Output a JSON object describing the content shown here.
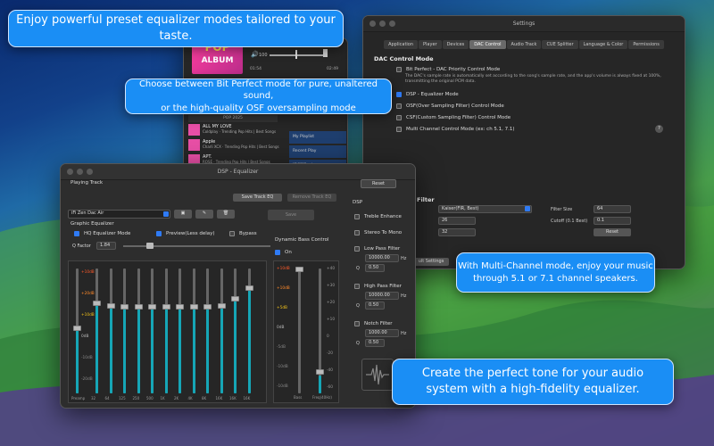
{
  "callouts": {
    "presets": "Enjoy powerful preset equalizer modes tailored to your taste.",
    "bitperfect_line1": "Choose between Bit Perfect mode for pure, unaltered sound,",
    "bitperfect_line2": "or the high-quality OSF oversampling mode",
    "multichannel_line1": "With Multi-Channel mode, enjoy your music",
    "multichannel_line2": "through 5.1 or 7.1 channel speakers.",
    "tone_line1": "Create the perfect tone for your audio",
    "tone_line2": "system with a high-fidelity equalizer."
  },
  "player": {
    "album_art_text": "POP",
    "album_art_sub": "ALBUM",
    "volume": "100",
    "time_elapsed": "01:54",
    "time_total": "02:49",
    "playlist_header": "POP 2025",
    "tracks": [
      {
        "title": "ALL MY LOVE",
        "artist": "Coldplay · Trending Pop Hits | Best Songs"
      },
      {
        "title": "Apple",
        "artist": "Charli XCX · Trending Pop Hits | Best Songs"
      },
      {
        "title": "APT.",
        "artist": "ROSÉ · Trending Pop Hits | Best Songs"
      }
    ],
    "side_items": [
      "My Playlist",
      "Recent Play",
      "[DSF]Eagles"
    ]
  },
  "settings": {
    "title": "Settings",
    "tabs": [
      "Application",
      "Player",
      "Devices",
      "DAC Control",
      "Audio Track",
      "CUE Splitter",
      "Language & Color",
      "Permissions"
    ],
    "active_tab": "DAC Control",
    "section": "DAC Control Mode",
    "options": [
      {
        "label": "Bit Perfect - DAC Priority Control Mode",
        "checked": false
      },
      {
        "label": "DSP - Equalizer Mode",
        "checked": true
      },
      {
        "label": "OSF(Over Sampling Filter) Control Mode",
        "checked": false
      },
      {
        "label": "CSF(Custom Sampling Filter) Control Mode",
        "checked": false
      },
      {
        "label": "Multi Channel Control Mode (ex: ch 5.1, 7.1)",
        "checked": false
      }
    ],
    "bitperfect_desc": "The DAC's sample rate is automatically set according to the song's sample rate, and the app's volume is always fixed at 100%, transmitting the original PCM data.",
    "filter_heading": "Filter",
    "filter_type": "Kaiser(FIR, Best)",
    "filter_size_label": "Filter Size",
    "filter_size": "64",
    "cutoff_label": "Cutoff (0.1 Best)",
    "cutoff": "0.1",
    "param1": "26",
    "param2": "32",
    "reset": "Reset",
    "default_btn": "ult Settings"
  },
  "eq": {
    "title": "DSP - Equalizer",
    "playing_track": "Playing Track",
    "reset": "Reset",
    "save_track_eq": "Save Track EQ",
    "remove_track_eq": "Remove Track EQ",
    "preset": "iFi Zen Dac Air",
    "save": "Save",
    "graphic_eq": "Graphic Equalizer",
    "hq_mode": "HQ Equalizer Mode",
    "preview": "Preview(Less delay)",
    "bypass": "Bypass",
    "q_factor_label": "Q Factor",
    "q_factor": "1.84",
    "db_labels": [
      "+10dB",
      "+20dB",
      "+10dB",
      "0dB",
      "-10dB",
      "-20dB"
    ],
    "bands": [
      {
        "freq": "Preamp",
        "level": 0.52
      },
      {
        "freq": "32",
        "level": 0.72
      },
      {
        "freq": "64",
        "level": 0.7
      },
      {
        "freq": "125",
        "level": 0.69
      },
      {
        "freq": "250",
        "level": 0.69
      },
      {
        "freq": "500",
        "level": 0.69
      },
      {
        "freq": "1K",
        "level": 0.69
      },
      {
        "freq": "2K",
        "level": 0.69
      },
      {
        "freq": "4K",
        "level": 0.69
      },
      {
        "freq": "8K",
        "level": 0.69
      },
      {
        "freq": "16K",
        "level": 0.7
      },
      {
        "freq": "16K",
        "level": 0.76
      },
      {
        "freq": "16K",
        "level": 0.84
      }
    ],
    "dynamic_bass": "Dynamic Bass Control",
    "on": "On",
    "bass_db_left": [
      "+10dB",
      "+10dB",
      "+5dB",
      "0dB",
      "-5dB",
      "-10dB",
      "-10dB"
    ],
    "bass_db_right": [
      "+40",
      "+30",
      "+20",
      "+10",
      "0",
      "-20",
      "-40",
      "-60"
    ],
    "bass_bottom": [
      "Bass",
      "Freq(40Hz)"
    ],
    "dsp": "DSP",
    "treble": "Treble Enhance",
    "stereo_mono": "Stereo To Mono",
    "low_pass": "Low Pass Filter",
    "low_pass_hz": "10000.00",
    "low_pass_q": "0.50",
    "high_pass": "High Pass Filter",
    "high_pass_hz": "10000.00",
    "high_pass_q": "0.50",
    "notch": "Notch Filter",
    "notch_hz": "1000.00",
    "notch_q": "0.50",
    "hz": "Hz",
    "q": "Q"
  }
}
